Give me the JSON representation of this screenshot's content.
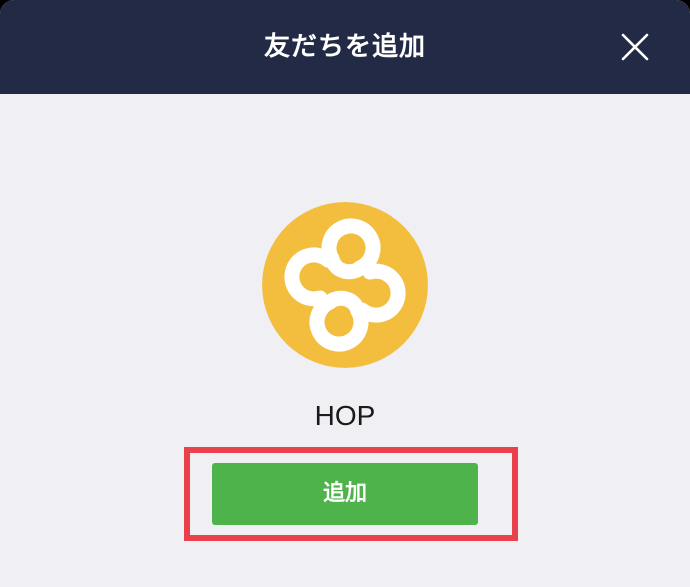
{
  "header": {
    "title": "友だちを追加",
    "background_color": "#222a45"
  },
  "close_button": {
    "icon": "close-icon"
  },
  "account": {
    "name": "HOP",
    "avatar_icon": "hop-logo-icon",
    "avatar_color": "#f3bd3e"
  },
  "actions": {
    "add_label": "追加",
    "add_button_color": "#4fb34c",
    "highlight_color": "#e8414c"
  },
  "background_color": "#efeff4"
}
